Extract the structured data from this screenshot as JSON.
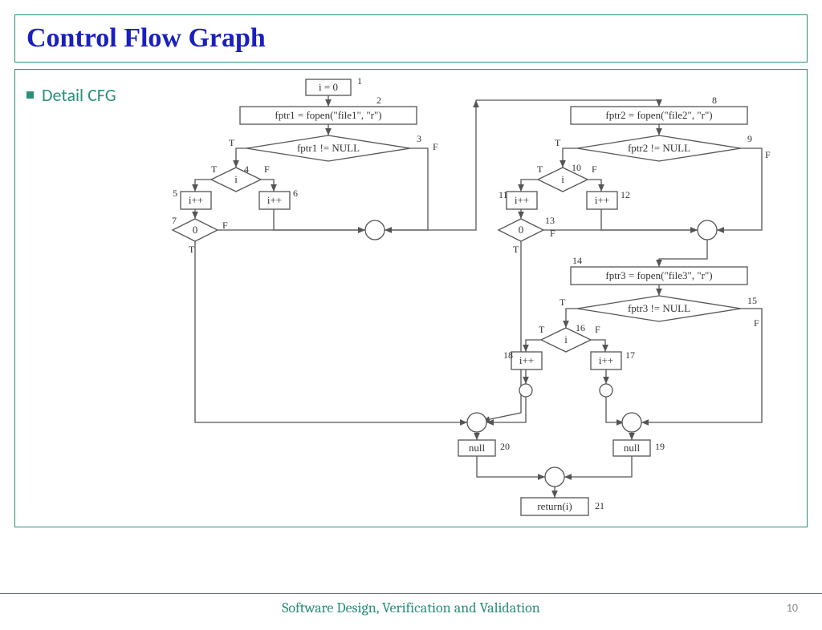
{
  "title": "Control Flow Graph",
  "bullet": "Detail CFG",
  "footer": "Software Design,  Verification and Validation",
  "page_number": "10",
  "diagram": {
    "nodes": {
      "n1": {
        "text": "i = 0",
        "label": "1"
      },
      "n2": {
        "text": "fptr1 = fopen(\"file1\", \"r\")",
        "label": "2"
      },
      "n3": {
        "text": "fptr1 != NULL",
        "label": "3"
      },
      "n4": {
        "text": "i",
        "label": "4"
      },
      "n5": {
        "text": "i++",
        "label": "5"
      },
      "n6": {
        "text": "i++",
        "label": "6"
      },
      "n7": {
        "text": "0",
        "label": "7"
      },
      "n8": {
        "text": "fptr2 = fopen(\"file2\", \"r\")",
        "label": "8"
      },
      "n9": {
        "text": "fptr2 != NULL",
        "label": "9"
      },
      "n10": {
        "text": "i",
        "label": "10"
      },
      "n11": {
        "text": "i++",
        "label": "11"
      },
      "n12": {
        "text": "i++",
        "label": "12"
      },
      "n13": {
        "text": "0",
        "label": "13"
      },
      "n14": {
        "text": "fptr3 = fopen(\"file3\", \"r\")",
        "label": "14"
      },
      "n15": {
        "text": "fptr3 != NULL",
        "label": "15"
      },
      "n16": {
        "text": "i",
        "label": "16"
      },
      "n17": {
        "text": "i++",
        "label": "17"
      },
      "n18": {
        "text": "i++",
        "label": "18"
      },
      "n19": {
        "text": "null",
        "label": "19"
      },
      "n20": {
        "text": "null",
        "label": "20"
      },
      "n21": {
        "text": "return(i)",
        "label": "21"
      }
    },
    "edge_labels": {
      "T": "T",
      "F": "F"
    }
  }
}
